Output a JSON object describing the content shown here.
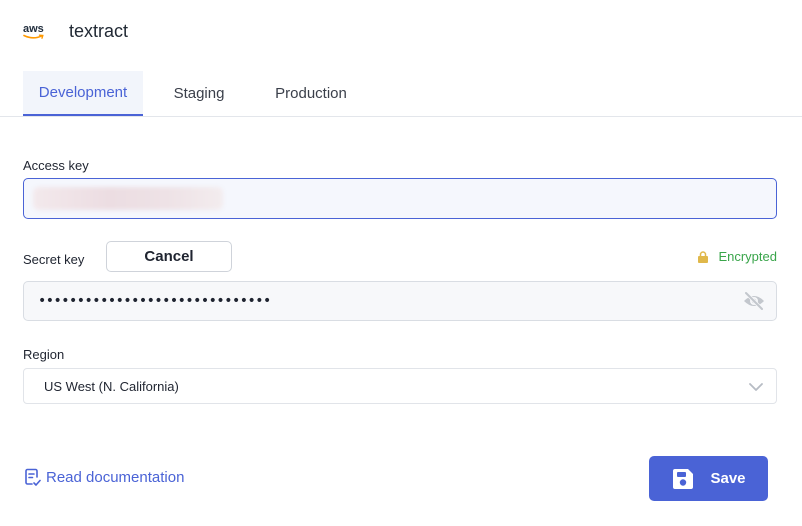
{
  "header": {
    "logo_text": "aws",
    "logo_icon": "aws-logo",
    "title": "textract"
  },
  "tabs": [
    {
      "label": "Development",
      "active": true
    },
    {
      "label": "Staging",
      "active": false
    },
    {
      "label": "Production",
      "active": false
    }
  ],
  "form": {
    "access_key": {
      "label": "Access key",
      "value": "",
      "value_redacted": true
    },
    "secret_key": {
      "label": "Secret key",
      "cancel_label": "Cancel",
      "encrypted_label": "Encrypted",
      "encrypted_icon": "lock-icon",
      "masked_value": "••••••••••••••••••••••••••••••",
      "toggle_icon": "eye-slash-icon"
    },
    "region": {
      "label": "Region",
      "selected": "US West (N. California)",
      "icon": "chevron-down-icon"
    }
  },
  "footer": {
    "docs_label": "Read documentation",
    "docs_icon": "document-check-icon",
    "save_label": "Save",
    "save_icon": "floppy-disk-icon"
  },
  "colors": {
    "accent": "#4a63d6",
    "success": "#3aa54b",
    "lock": "#e0b84a"
  }
}
